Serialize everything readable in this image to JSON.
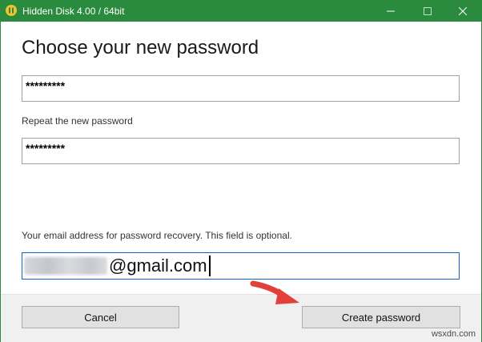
{
  "window": {
    "title": "Hidden Disk 4.00 / 64bit",
    "title_bar_color": "#2a8a3e",
    "app_icon": "app-logo-icon",
    "controls": {
      "minimize_icon": "minimize-icon",
      "maximize_icon": "maximize-icon",
      "close_icon": "close-icon"
    }
  },
  "form": {
    "heading": "Choose your new password",
    "password_value": "*********",
    "repeat_label": "Repeat the new password",
    "repeat_value": "*********",
    "email_label": "Your email address for password recovery. This field is optional.",
    "email_visible_part": "@gmail.com",
    "email_focus_color": "#0a64c8"
  },
  "footer": {
    "cancel_label": "Cancel",
    "create_label": "Create password"
  },
  "annotation": {
    "arrow_color": "#e2403a",
    "arrow_icon": "pointer-arrow-icon"
  },
  "watermark": "wsxdn.com"
}
